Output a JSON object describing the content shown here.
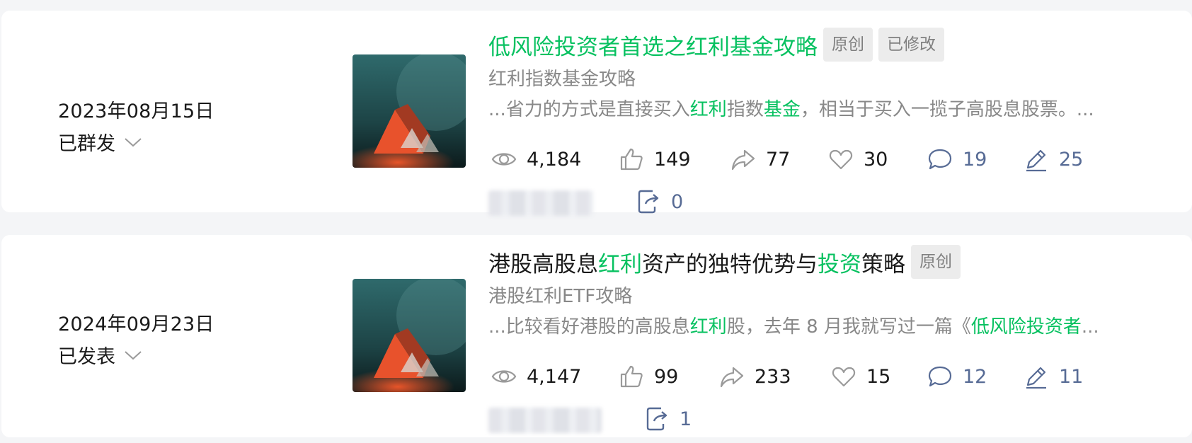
{
  "articles": [
    {
      "date": "2023年08月15日",
      "status": "已群发",
      "title_parts": [
        {
          "text": "低风险投资者首选之红利基金攻略",
          "hl": true
        }
      ],
      "tags": [
        "原创",
        "已修改"
      ],
      "subtitle": "红利指数基金攻略",
      "digest_parts": [
        {
          "text": "...省力的方式是直接买入",
          "hl": false
        },
        {
          "text": "红利",
          "hl": true
        },
        {
          "text": "指数",
          "hl": false
        },
        {
          "text": "基金",
          "hl": true
        },
        {
          "text": "，相当于买入一揽子高股息股票。...",
          "hl": false
        }
      ],
      "stats": {
        "reads": "4,184",
        "likes": "149",
        "shares": "77",
        "favorites": "30",
        "comments": "19",
        "edits": "25"
      },
      "forwards": "0"
    },
    {
      "date": "2024年09月23日",
      "status": "已发表",
      "title_parts": [
        {
          "text": "港股高股息",
          "hl": false
        },
        {
          "text": "红利",
          "hl": true
        },
        {
          "text": "资产的独特优势与",
          "hl": false
        },
        {
          "text": "投资",
          "hl": true
        },
        {
          "text": "策略",
          "hl": false
        }
      ],
      "tags": [
        "原创"
      ],
      "subtitle": "港股红利ETF攻略",
      "digest_parts": [
        {
          "text": "...比较看好港股的高股息",
          "hl": false
        },
        {
          "text": "红利",
          "hl": true
        },
        {
          "text": "股，去年 8 月我就写过一篇《",
          "hl": false
        },
        {
          "text": "低风险投资者",
          "hl": true
        },
        {
          "text": "...",
          "hl": false
        }
      ],
      "stats": {
        "reads": "4,147",
        "likes": "99",
        "shares": "233",
        "favorites": "15",
        "comments": "12",
        "edits": "11"
      },
      "forwards": "1"
    }
  ],
  "colors": {
    "highlight": "#07c160",
    "link_blue": "#576b95",
    "text": "#1a1a1a",
    "muted": "#888888"
  },
  "icons": {
    "reads": "eye-icon",
    "likes": "thumbs-up-icon",
    "shares": "share-arrow-icon",
    "favorites": "heart-icon",
    "comments": "comment-icon",
    "edits": "pen-icon",
    "forwards": "forward-icon",
    "status": "chevron-down-icon"
  }
}
